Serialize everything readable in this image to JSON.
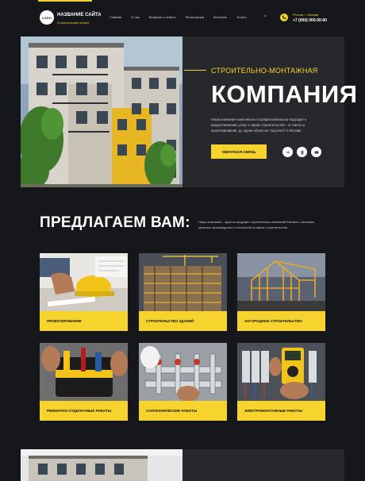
{
  "header": {
    "logo": "LOGO",
    "site_name": "НАЗВАНИЕ САЙТА",
    "site_sub": "Строительные услуги",
    "nav": [
      "Главная",
      "О нас",
      "Вопросы и ответы",
      "Регистрация",
      "Контакты",
      "Услуги"
    ],
    "close_glyph": "×",
    "city": "Россия, г. Москва",
    "phone": "+7 (000) 000-00-00"
  },
  "hero": {
    "eyebrow": "СТРОИТЕЛЬНО-МОНТАЖНАЯ",
    "title": "КОМПАНИЯ",
    "description": "Наша компания комплексно и профессионально подходит к предоставлению услуг в сфере строительства - от сметы и проектирования, до сдачи объектов \"под ключ\" в Москве",
    "button": "ОБРАТНАЯ СВЯЗЬ",
    "socials": [
      "vk-icon",
      "ok-icon",
      "youtube-icon"
    ]
  },
  "offer": {
    "title": "ПРЕДЛАГАЕМ ВАМ:",
    "description": "Наша компания - одна из ведущих строительных компаний Москвы с высоким уровнем производства и технологий в сфере строительства"
  },
  "services": [
    {
      "label": "ПРОЕКТИРОВАНИЕ"
    },
    {
      "label": "СТРОИТЕЛЬСТВО ЗДАНИЙ"
    },
    {
      "label": "ЗАГОРОДНОЕ СТРОИТЕЛЬСТВО"
    },
    {
      "label": "РЕМОНТНО-ОТДЕЛОЧНЫЕ РАБОТЫ"
    },
    {
      "label": "САНТЕХНИЧЕСКИЕ РАБОТЫ"
    },
    {
      "label": "ЭЛЕКТРОМОНТАЖНЫЕ РАБОТЫ"
    }
  ],
  "colors": {
    "accent": "#f6d32d",
    "background": "#16171a",
    "panel": "#27282c"
  }
}
